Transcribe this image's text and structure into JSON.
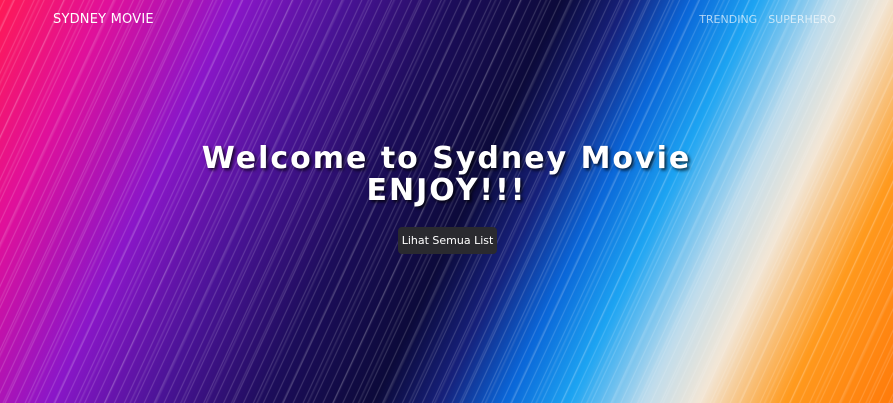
{
  "nav": {
    "brand": "SYDNEY MOVIE",
    "links": [
      {
        "label": "TRENDING"
      },
      {
        "label": "SUPERHERO"
      }
    ]
  },
  "hero": {
    "headline_line1": "Welcome to Sydney Movie",
    "headline_line2": "ENJOY!!!",
    "cta_label": "Lihat Semua List"
  },
  "colors": {
    "cta_background": "#2a2a2f",
    "text": "#ffffff"
  }
}
